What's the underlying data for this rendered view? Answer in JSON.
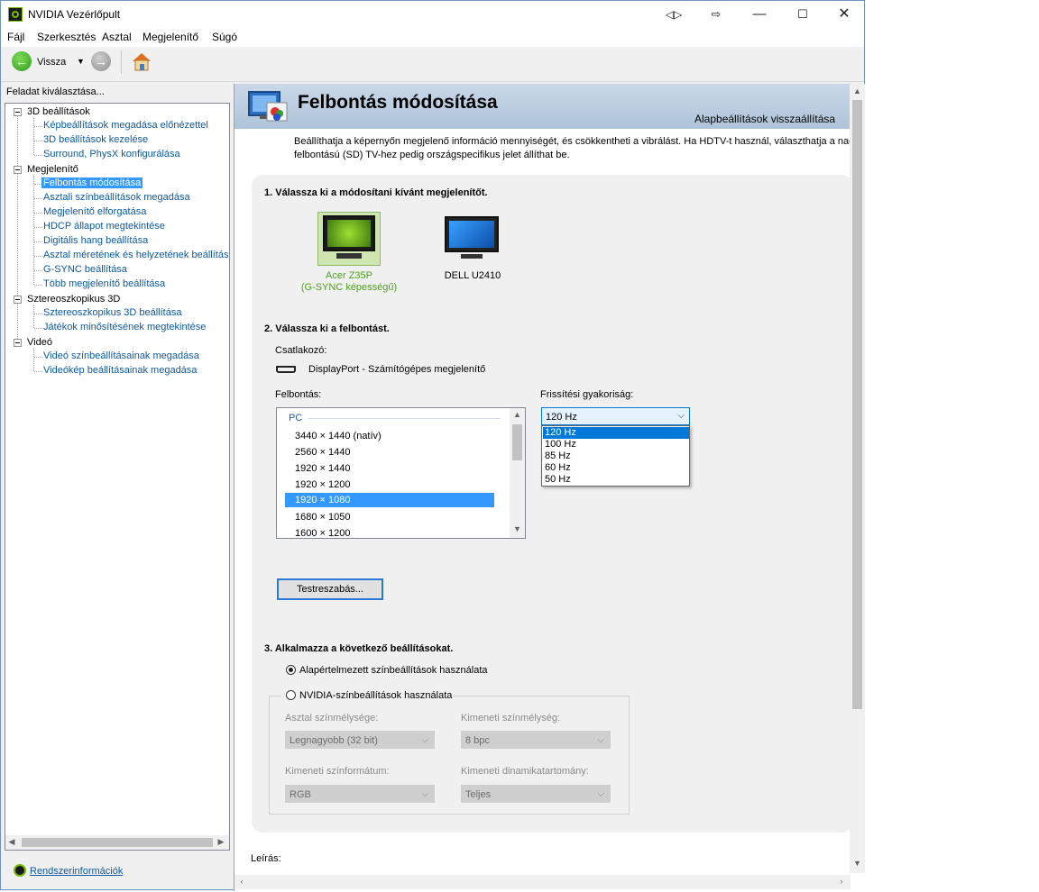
{
  "window": {
    "title": "NVIDIA Vezérlőpult"
  },
  "menu": [
    "Fájl",
    "Szerkesztés",
    "Asztal",
    "Megjelenítő",
    "Súgó"
  ],
  "toolbar": {
    "back_label": "Vissza"
  },
  "left": {
    "header": "Feladat kiválasztása...",
    "tree": [
      {
        "label": "3D beállítások",
        "children": [
          "Képbeállítások megadása előnézettel",
          "3D beállítások kezelése",
          "Surround, PhysX konfigurálása"
        ]
      },
      {
        "label": "Megjelenítő",
        "children": [
          "Felbontás módosítása",
          "Asztali színbeállítások megadása",
          "Megjelenítő elforgatása",
          "HDCP állapot megtekintése",
          "Digitális hang beállítása",
          "Asztal méretének és helyzetének beállítása",
          "G-SYNC beállítása",
          "Több megjelenítő beállítása"
        ]
      },
      {
        "label": "Sztereoszkopikus 3D",
        "children": [
          "Sztereoszkopikus 3D beállítása",
          "Játékok minősítésének megtekintése"
        ]
      },
      {
        "label": "Videó",
        "children": [
          "Videó színbeállításainak megadása",
          "Videókép beállításainak megadása"
        ]
      }
    ],
    "selected": "Felbontás módosítása",
    "sysinfo": "Rendszerinformációk"
  },
  "page": {
    "title": "Felbontás módosítása",
    "restore": "Alapbeállítások visszaállítása",
    "desc_line1": "Beállíthatja a képernyőn megjelenő információ mennyiségét, és csökkentheti a vibrálást. Ha HDTV-t használ, választhatja a nagy fe",
    "desc_line2": "felbontású (SD) TV-hez pedig országspecifikus jelet állíthat be.",
    "step1": "1. Válassza ki a módosítani kívánt megjelenítőt.",
    "monitors": [
      {
        "name": "Acer Z35P",
        "sub": "(G-SYNC képességű)"
      },
      {
        "name": "DELL U2410"
      }
    ],
    "step2": "2. Válassza ki a felbontást.",
    "connector_label": "Csatlakozó:",
    "connector_value": "DisplayPort - Számítógépes megjelenítő",
    "resolution_label": "Felbontás:",
    "resolution_group": "PC",
    "resolutions": [
      "3440 × 1440 (natív)",
      "2560 × 1440",
      "1920 × 1440",
      "1920 × 1200",
      "1920 × 1080",
      "1680 × 1050",
      "1600 × 1200"
    ],
    "selected_resolution": "1920 × 1080",
    "refresh_label": "Frissítési gyakoriság:",
    "refresh_selected": "120 Hz",
    "refresh_options": [
      "120 Hz",
      "100 Hz",
      "85 Hz",
      "60 Hz",
      "50 Hz"
    ],
    "customize_btn": "Testreszabás...",
    "step3": "3. Alkalmazza a következő beállításokat.",
    "radio_default": "Alapértelmezett színbeállítások használata",
    "radio_nvidia": "NVIDIA-színbeállítások használata",
    "desktop_depth_label": "Asztal színmélysége:",
    "desktop_depth_value": "Legnagyobb (32 bit)",
    "output_depth_label": "Kimeneti színmélység:",
    "output_depth_value": "8 bpc",
    "output_format_label": "Kimeneti színformátum:",
    "output_format_value": "RGB",
    "output_range_label": "Kimeneti dinamikatartomány:",
    "output_range_value": "Teljes",
    "description_label": "Leírás:"
  },
  "colors": {
    "accent": "#76b900",
    "selection": "#3399ff",
    "link": "#0b5aa5"
  }
}
